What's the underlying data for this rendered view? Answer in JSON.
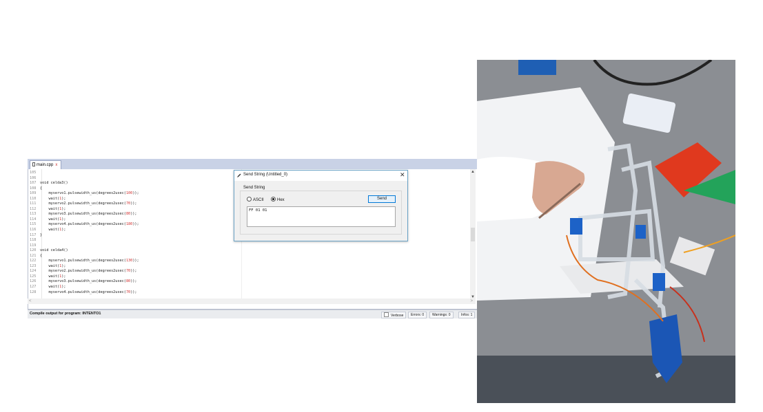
{
  "editor": {
    "tab_label": "main.cpp",
    "tab_close": "x",
    "lines": [
      {
        "n": "105",
        "code": [
          {
            "t": ""
          }
        ]
      },
      {
        "n": "106",
        "code": [
          {
            "t": ""
          }
        ]
      },
      {
        "n": "107",
        "code": [
          {
            "t": "void celda3()"
          }
        ]
      },
      {
        "n": "108",
        "code": [
          {
            "t": "{"
          }
        ]
      },
      {
        "n": "109",
        "code": [
          {
            "t": "    myservo1.pulsewidth_us(degrees2usec("
          },
          {
            "t": "100",
            "num": true
          },
          {
            "t": "));"
          }
        ]
      },
      {
        "n": "110",
        "code": [
          {
            "t": "    wait("
          },
          {
            "t": "1",
            "num": true
          },
          {
            "t": ");"
          }
        ]
      },
      {
        "n": "111",
        "code": [
          {
            "t": "    myservo2.pulsewidth_us(degrees2usec("
          },
          {
            "t": "70",
            "num": true
          },
          {
            "t": "));"
          }
        ]
      },
      {
        "n": "112",
        "code": [
          {
            "t": "    wait("
          },
          {
            "t": "1",
            "num": true
          },
          {
            "t": ");"
          }
        ]
      },
      {
        "n": "113",
        "code": [
          {
            "t": "    myservo3.pulsewidth_us(degrees2usec("
          },
          {
            "t": "80",
            "num": true
          },
          {
            "t": "));"
          }
        ]
      },
      {
        "n": "114",
        "code": [
          {
            "t": "    wait("
          },
          {
            "t": "1",
            "num": true
          },
          {
            "t": ");"
          }
        ]
      },
      {
        "n": "115",
        "code": [
          {
            "t": "    myservo4.pulsewidth_us(degrees2usec("
          },
          {
            "t": "180",
            "num": true
          },
          {
            "t": "));"
          }
        ]
      },
      {
        "n": "116",
        "code": [
          {
            "t": "    wait("
          },
          {
            "t": "1",
            "num": true
          },
          {
            "t": ");"
          }
        ]
      },
      {
        "n": "117",
        "code": [
          {
            "t": "}"
          }
        ]
      },
      {
        "n": "118",
        "code": [
          {
            "t": ""
          }
        ]
      },
      {
        "n": "119",
        "code": [
          {
            "t": ""
          }
        ]
      },
      {
        "n": "120",
        "code": [
          {
            "t": "void celda4()"
          }
        ]
      },
      {
        "n": "121",
        "code": [
          {
            "t": "{"
          }
        ]
      },
      {
        "n": "122",
        "code": [
          {
            "t": "    myservo1.pulsewidth_us(degrees2usec("
          },
          {
            "t": "130",
            "num": true
          },
          {
            "t": "));"
          }
        ]
      },
      {
        "n": "123",
        "code": [
          {
            "t": "    wait("
          },
          {
            "t": "1",
            "num": true
          },
          {
            "t": ");"
          }
        ]
      },
      {
        "n": "124",
        "code": [
          {
            "t": "    myservo2.pulsewidth_us(degrees2usec("
          },
          {
            "t": "70",
            "num": true
          },
          {
            "t": "));"
          }
        ]
      },
      {
        "n": "125",
        "code": [
          {
            "t": "    wait("
          },
          {
            "t": "1",
            "num": true
          },
          {
            "t": ");"
          }
        ]
      },
      {
        "n": "126",
        "code": [
          {
            "t": "    myservo3.pulsewidth_us(degrees2usec("
          },
          {
            "t": "80",
            "num": true
          },
          {
            "t": "));"
          }
        ]
      },
      {
        "n": "127",
        "code": [
          {
            "t": "    wait("
          },
          {
            "t": "1",
            "num": true
          },
          {
            "t": ");"
          }
        ]
      },
      {
        "n": "128",
        "code": [
          {
            "t": "    myservo4.pulsewidth_us(degrees2usec("
          },
          {
            "t": "70",
            "num": true
          },
          {
            "t": "));"
          }
        ]
      }
    ]
  },
  "output": {
    "title": "Compile output for program: INTENTO1",
    "verbose_label": "Verbose",
    "errors": "Errors: 0",
    "warnings": "Warnings: 0",
    "infos": "Infos: 1"
  },
  "dialog": {
    "title": "Send String (Untitled_0)",
    "close": "✕",
    "group_label": "Send String",
    "ascii_label": "ASCII",
    "hex_label": "Hex",
    "selected_mode": "Hex",
    "send_label": "Send",
    "input_value": "FF 01 01"
  },
  "colors": {
    "tabbar": "#c9d2e6",
    "number": "#d0302f",
    "dialog_border": "#6aa3c6",
    "send_border": "#0078d7"
  },
  "icons": {
    "file": "file-icon",
    "dialog": "pen-icon",
    "scroll_up": "▲",
    "scroll_down": "▼",
    "scroll_left": "<",
    "scroll_right": ">"
  }
}
